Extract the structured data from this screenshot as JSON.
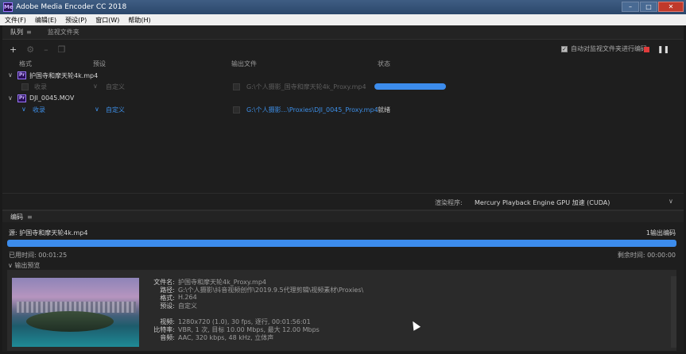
{
  "window": {
    "title": "Adobe Media Encoder CC 2018",
    "app_icon": "Me"
  },
  "menu": [
    "文件(F)",
    "编辑(E)",
    "预设(P)",
    "窗口(W)",
    "帮助(H)"
  ],
  "queue_tabs": {
    "queue": "队列",
    "watch_folders": "监视文件夹"
  },
  "toolbar": {
    "auto_encode_label": "自动对监视文件夹进行编码"
  },
  "columns": {
    "format": "格式",
    "preset": "预设",
    "output": "输出文件",
    "status": "状态"
  },
  "queue": [
    {
      "source": "护国寺和摩天轮4k.mp4",
      "format": "收录",
      "preset": "自定义",
      "output": "G:\\个人摄影_国寺和摩天轮4k_Proxy.mp4",
      "status_progress": 1.0,
      "status": ""
    },
    {
      "source": "DJI_0045.MOV",
      "format": "收录",
      "preset": "自定义",
      "output": "G:\\个人摄影...\\Proxies\\DJI_0045_Proxy.mp4",
      "status": "就绪"
    }
  ],
  "renderer": {
    "label": "渲染程序:",
    "value": "Mercury Playback Engine GPU 加速 (CUDA)"
  },
  "encoding": {
    "tab": "编码",
    "source_line": "源: 护国寺和摩天轮4k.mp4",
    "output_count": "1输出编码",
    "progress": 1.0,
    "elapsed": "已用时间: 00:01:25",
    "remaining": "剩余时间: 00:00:00",
    "preview_header": "输出预览",
    "info": [
      {
        "k": "文件名:",
        "v": "护国寺和摩天轮4k_Proxy.mp4"
      },
      {
        "k": "路径:",
        "v": "G:\\个人摄影\\抖音视频创作\\2019.9.5代理剪辑\\视频素材\\Proxies\\"
      },
      {
        "k": "格式:",
        "v": "H.264"
      },
      {
        "k": "预设:",
        "v": "自定义"
      },
      {
        "k": "视频:",
        "v": "1280x720 (1.0), 30 fps, 逐行, 00:01:56:01"
      },
      {
        "k": "比特率:",
        "v": "VBR, 1 次, 目标 10.00 Mbps, 最大 12.00 Mbps"
      },
      {
        "k": "音频:",
        "v": "AAC, 320 kbps, 48 kHz, 立体声"
      }
    ]
  }
}
